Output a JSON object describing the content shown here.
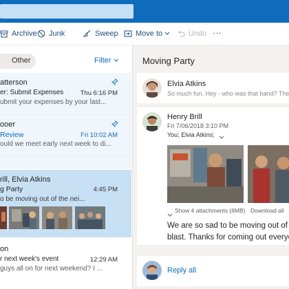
{
  "toolbar": {
    "archive": "Archive",
    "junk": "Junk",
    "sweep": "Sweep",
    "move_to": "Move to",
    "undo": "Undo",
    "more": "···"
  },
  "list": {
    "tab_other": "Other",
    "filter": "Filter",
    "messages": [
      {
        "sender": "atterson",
        "subject": "er: Submit Expenses",
        "time": "Thu 6:16 PM",
        "preview": "ubmit your expenses by your last..."
      },
      {
        "sender": "ooer",
        "subject": "Review",
        "time": "Fri 10:02 AM",
        "preview": "ould we meet early next week to di..."
      },
      {
        "sender": "rill, Elvia Atkins",
        "subject": "g Party",
        "time": "4:45 PM",
        "preview": "o be moving out of the nei..."
      },
      {
        "sender": "on",
        "subject": "r next week's event",
        "time": "12:29 AM",
        "preview": "guys all on for next weekend? I ..."
      }
    ]
  },
  "reading": {
    "subject": "Moving Party",
    "thread": [
      {
        "sender": "Elvia Atkins",
        "preview": "So much fun. Hey - who was that band? They ro"
      },
      {
        "sender": "Henry Brill",
        "date": "Fri 7/06/2018 3:10 PM",
        "to": "You; Elvia Atkins;",
        "attachments": "Show 4 attachments (6MB)",
        "download": "Download all",
        "body_line1": "We are so sad to be moving out of the",
        "body_line2": "blast. Thanks for coming out everyon"
      }
    ],
    "reply_all": "Reply all"
  }
}
